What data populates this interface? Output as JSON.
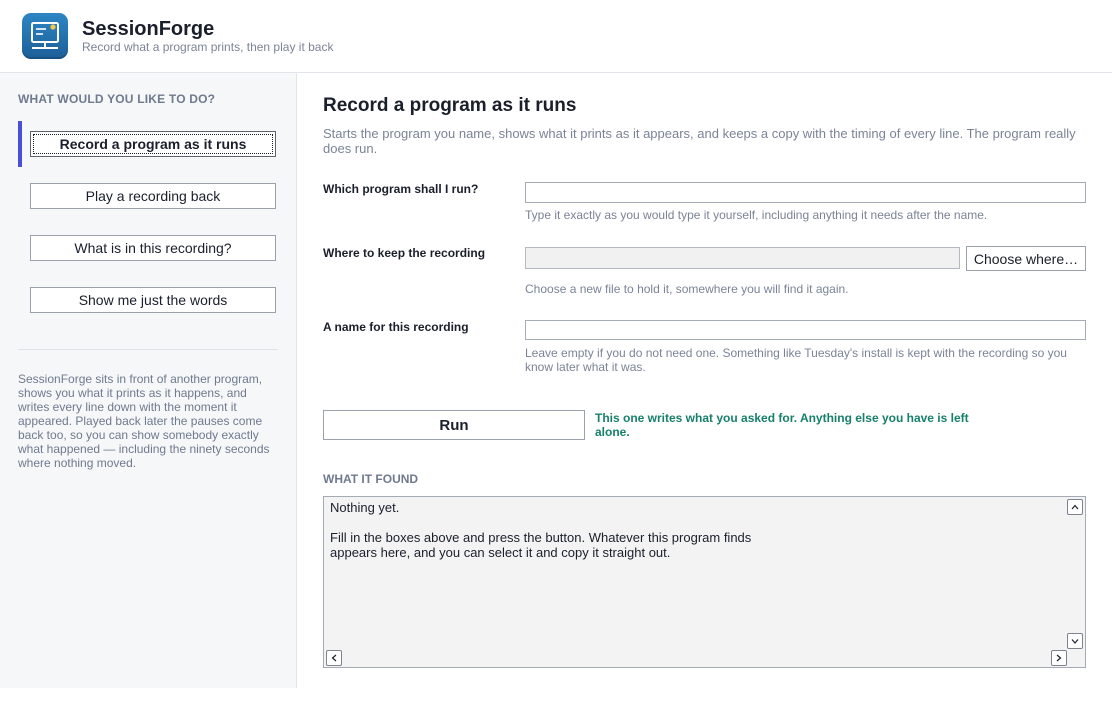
{
  "header": {
    "title": "SessionForge",
    "subtitle": "Record what a program prints, then play it back",
    "logo_icon": "monitor-icon",
    "accent": "#1c5e97"
  },
  "sidebar": {
    "heading": "WHAT WOULD YOU LIKE TO DO?",
    "items": [
      {
        "label": "Record a program as it runs",
        "active": true
      },
      {
        "label": "Play a recording back",
        "active": false
      },
      {
        "label": "What is in this recording?",
        "active": false
      },
      {
        "label": "Show me just the words",
        "active": false
      }
    ],
    "about": "SessionForge sits in front of another program, shows you what it prints as it happens, and writes every line down with the moment it appeared. Played back later the pauses come back too, so you can show somebody exactly what happened — including the ninety seconds where nothing moved.",
    "active_marker_color": "#4a4fd8"
  },
  "main": {
    "title": "Record a program as it runs",
    "description": "Starts the program you name, shows what it prints as it appears, and keeps a copy with the timing of every line. The program really does run.",
    "fields": {
      "program": {
        "label": "Which program shall I run?",
        "value": "",
        "hint": "Type it exactly as you would type it yourself, including anything it needs after the name."
      },
      "location": {
        "label": "Where to keep the recording",
        "value": "",
        "button": "Choose where…",
        "hint": "Choose a new file to hold it, somewhere you will find it again."
      },
      "name": {
        "label": "A name for this recording",
        "value": "",
        "hint": "Leave empty if you do not need one. Something like Tuesday's install is kept with the recording so you know later what it was."
      }
    },
    "run_button": "Run",
    "run_note": "This one writes what you asked for. Anything else you have is left alone.",
    "run_note_color": "#17806b",
    "output": {
      "heading": "WHAT IT FOUND",
      "text": "Nothing yet.\n\nFill in the boxes above and press the button. Whatever this program finds\nappears here, and you can select it and copy it straight out."
    }
  }
}
